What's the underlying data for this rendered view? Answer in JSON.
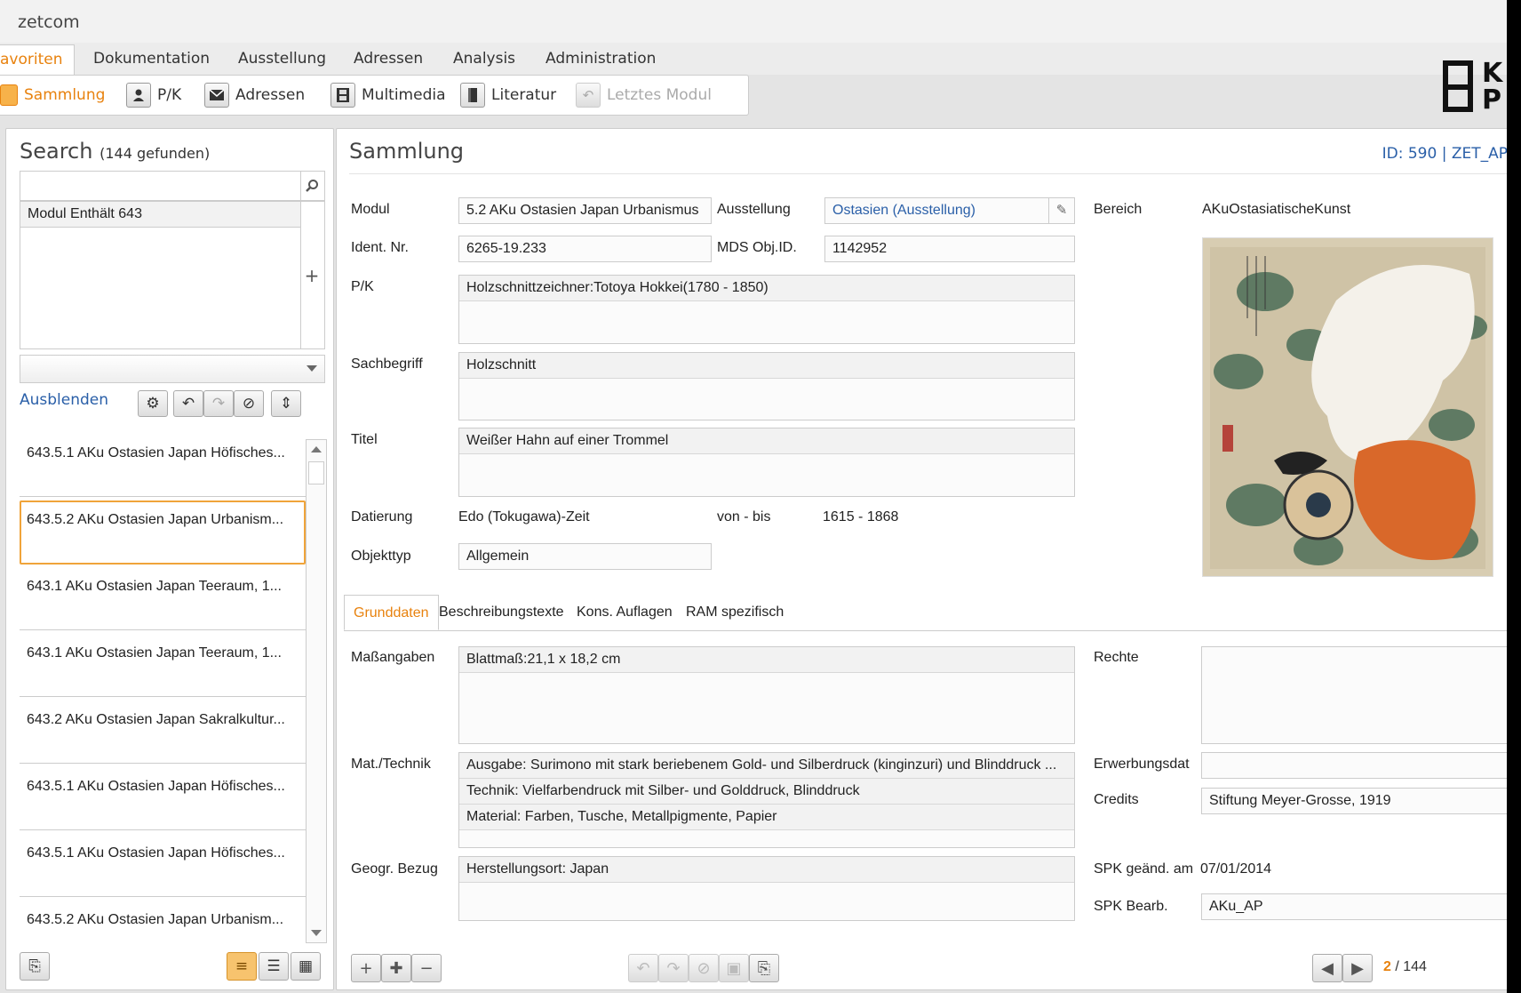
{
  "app": {
    "title": "zetcom"
  },
  "menu": {
    "items": [
      "avoriten",
      "Dokumentation",
      "Ausstellung",
      "Adressen",
      "Analysis",
      "Administration"
    ]
  },
  "toolbar": {
    "sammlung": "Sammlung",
    "pk": "P/K",
    "adressen": "Adressen",
    "multimedia": "Multimedia",
    "literatur": "Literatur",
    "letztes": "Letztes Modul"
  },
  "search": {
    "title": "Search",
    "count": "(144 gefunden)",
    "criteria": "Modul Enthält 643",
    "hide": "Ausblenden",
    "results": [
      "643.5.1 AKu Ostasien Japan Höfisches...",
      "643.5.2 AKu Ostasien Japan Urbanism...",
      "643.1 AKu Ostasien Japan Teeraum, 1...",
      "643.1 AKu Ostasien Japan Teeraum, 1...",
      "643.2 AKu Ostasien Japan Sakralkultur...",
      "643.5.1 AKu Ostasien Japan Höfisches...",
      "643.5.1 AKu Ostasien Japan Höfisches...",
      "643.5.2 AKu Ostasien Japan Urbanism..."
    ],
    "selected_index": 1
  },
  "record": {
    "title": "Sammlung",
    "id": "ID: 590 | ZET_AP",
    "labels": {
      "modul": "Modul",
      "ausstellung": "Ausstellung",
      "bereich": "Bereich",
      "ident": "Ident. Nr.",
      "mds": "MDS Obj.ID.",
      "pk": "P/K",
      "sachbegriff": "Sachbegriff",
      "titel": "Titel",
      "datierung": "Datierung",
      "vonbis": "von - bis",
      "objekttyp": "Objekttyp"
    },
    "values": {
      "modul": "5.2 AKu Ostasien Japan Urbanismus",
      "ausstellung": "Ostasien (Ausstellung)",
      "bereich": "AKuOstasiatischeKunst",
      "ident": "6265-19.233",
      "mds": "1142952",
      "pk": "Holzschnittzeichner:Totoya Hokkei(1780 - 1850)",
      "sachbegriff": "Holzschnitt",
      "titel": "Weißer Hahn auf einer Trommel",
      "datierung": "Edo (Tokugawa)-Zeit",
      "vonbis": "1615 - 1868",
      "objekttyp": "Allgemein"
    }
  },
  "tabs": [
    "Grunddaten",
    "Beschreibungstexte",
    "Kons. Auflagen",
    "RAM spezifisch"
  ],
  "details": {
    "labels": {
      "mass": "Maßangaben",
      "mat": "Mat./Technik",
      "geogr": "Geogr. Bezug",
      "rechte": "Rechte",
      "erwerb": "Erwerbungsdat",
      "credits": "Credits",
      "spkdate": "SPK geänd. am",
      "spkbearb": "SPK Bearb."
    },
    "values": {
      "mass": "Blattmaß:21,1 x 18,2 cm",
      "mat": [
        "Ausgabe: Surimono mit stark beriebenem Gold- und Silberdruck (kinginzuri) und Blinddruck ...",
        "Technik: Vielfarbendruck mit Silber- und Golddruck, Blinddruck",
        "Material: Farben, Tusche, Metallpigmente, Papier"
      ],
      "geogr": "Herstellungsort: Japan",
      "credits": "Stiftung Meyer-Grosse, 1919",
      "spkdate": "07/01/2014",
      "spkbearb": "AKu_AP"
    }
  },
  "pager": {
    "current": "2",
    "total": "/ 144"
  }
}
